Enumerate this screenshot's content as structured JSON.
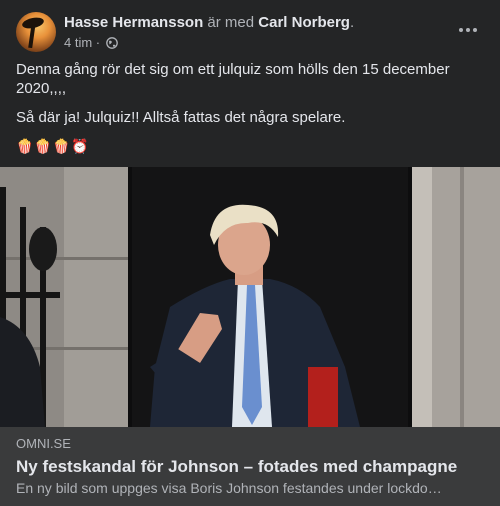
{
  "post": {
    "author": "Hasse Hermansson",
    "with_text": "är med",
    "tagged": "Carl Norberg",
    "tagged_suffix": ".",
    "time": "4 tim ·",
    "body_line1": "Denna gång rör det sig om ett julquiz som hölls den 15 december 2020,,,,",
    "body_line2": "Så där ja! Julquiz!! Alltså fattas det några spelare.",
    "emojis": "🍿🍿🍿⏰"
  },
  "icons": {
    "more": "more-options-icon",
    "privacy": "globe-icon"
  },
  "link": {
    "domain": "OMNI.SE",
    "title": "Ny festskandal för Johnson – fotades med champagne",
    "description": "En ny bild som uppges visa Boris Johnson festandes under lockdo…"
  },
  "colors": {
    "background": "#242526",
    "card": "#3a3b3c",
    "primary_text": "#e4e6eb",
    "secondary_text": "#b0b3b8"
  }
}
